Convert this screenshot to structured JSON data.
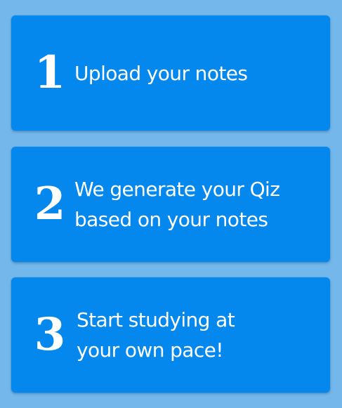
{
  "steps": [
    {
      "number": "1",
      "lines": [
        "Upload your notes"
      ]
    },
    {
      "number": "2",
      "lines": [
        "We generate your Qiz",
        "based on your notes"
      ]
    },
    {
      "number": "3",
      "lines": [
        "Start studying at",
        "your own pace!"
      ]
    }
  ],
  "colors": {
    "background": "#74b7ea",
    "card": "#0588ee",
    "text": "#ffffff"
  }
}
